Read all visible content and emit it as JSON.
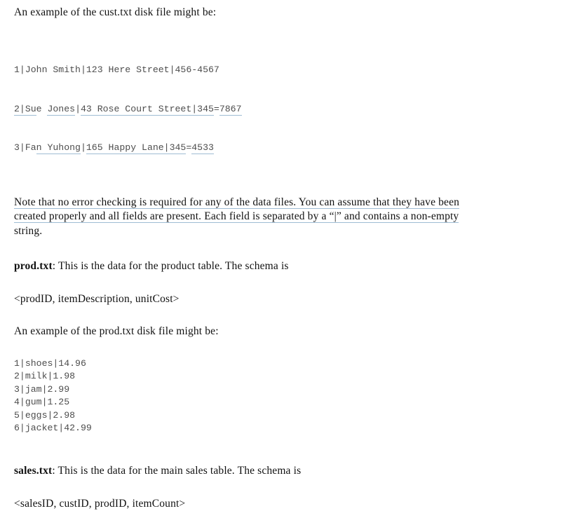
{
  "document": {
    "background_color": "#ffffff",
    "text_color": "#111111",
    "code_color": "#4d4d4d",
    "underline_color": "#9fbcd4",
    "intro_cust": "An example of the cust.txt disk file might be:",
    "cust_file": {
      "lines": [
        "1|John Smith|123 Here Street|456-4567",
        "2|Sue Jones|43 Rose Court Street|345-7867",
        "3|Fan Yuhong|165 Happy Lane|345-4533"
      ],
      "line2_segments": [
        {
          "text": "2|Su",
          "underlined": true
        },
        {
          "text": "e ",
          "underlined": false
        },
        {
          "text": "Jones",
          "underlined": true
        },
        {
          "text": "|",
          "underlined": false
        },
        {
          "text": "43 Rose Court Street|345",
          "underlined": true
        },
        {
          "text": "=",
          "underlined": false
        },
        {
          "text": "7867",
          "underlined": true
        }
      ],
      "line1_segments": [
        {
          "text": "1|John Smith|123 Here Street|456-4567",
          "underlined": false
        }
      ],
      "line3_segments": [
        {
          "text": "3|Fa",
          "underlined": false
        },
        {
          "text": "n Yuhong",
          "underlined": true
        },
        {
          "text": "|",
          "underlined": false
        },
        {
          "text": "165 Happy Lane|345",
          "underlined": true
        },
        {
          "text": "=",
          "underlined": false
        },
        {
          "text": "4533",
          "underlined": true
        }
      ]
    },
    "note_paragraph": {
      "line1": "Note that no error checking is required for any of the data files. You can assume that they have been",
      "line2": "created properly and all fields are present. Each field is separated by a “|” and contains a non-empty",
      "line3": "string.",
      "full": "Note that no error checking is required for any of the data files. You can assume that they have been created properly and all fields are present. Each field is separated by a “|” and contains a non-empty string."
    },
    "prod_section": {
      "file_label": "prod.txt",
      "description": ": This is the data for the product table. The schema is",
      "schema": "<prodID, itemDescription, unitCost>",
      "intro_example": "An example of the prod.txt disk file might be:",
      "lines": [
        "1|shoes|14.96",
        "2|milk|1.98",
        "3|jam|2.99",
        "4|gum|1.25",
        "5|eggs|2.98",
        "6|jacket|42.99"
      ]
    },
    "sales_section": {
      "file_label": "sales.txt",
      "description": ": This is the data for the main sales table. The schema is",
      "schema": "<salesID, custID, prodID, itemCount>"
    }
  }
}
